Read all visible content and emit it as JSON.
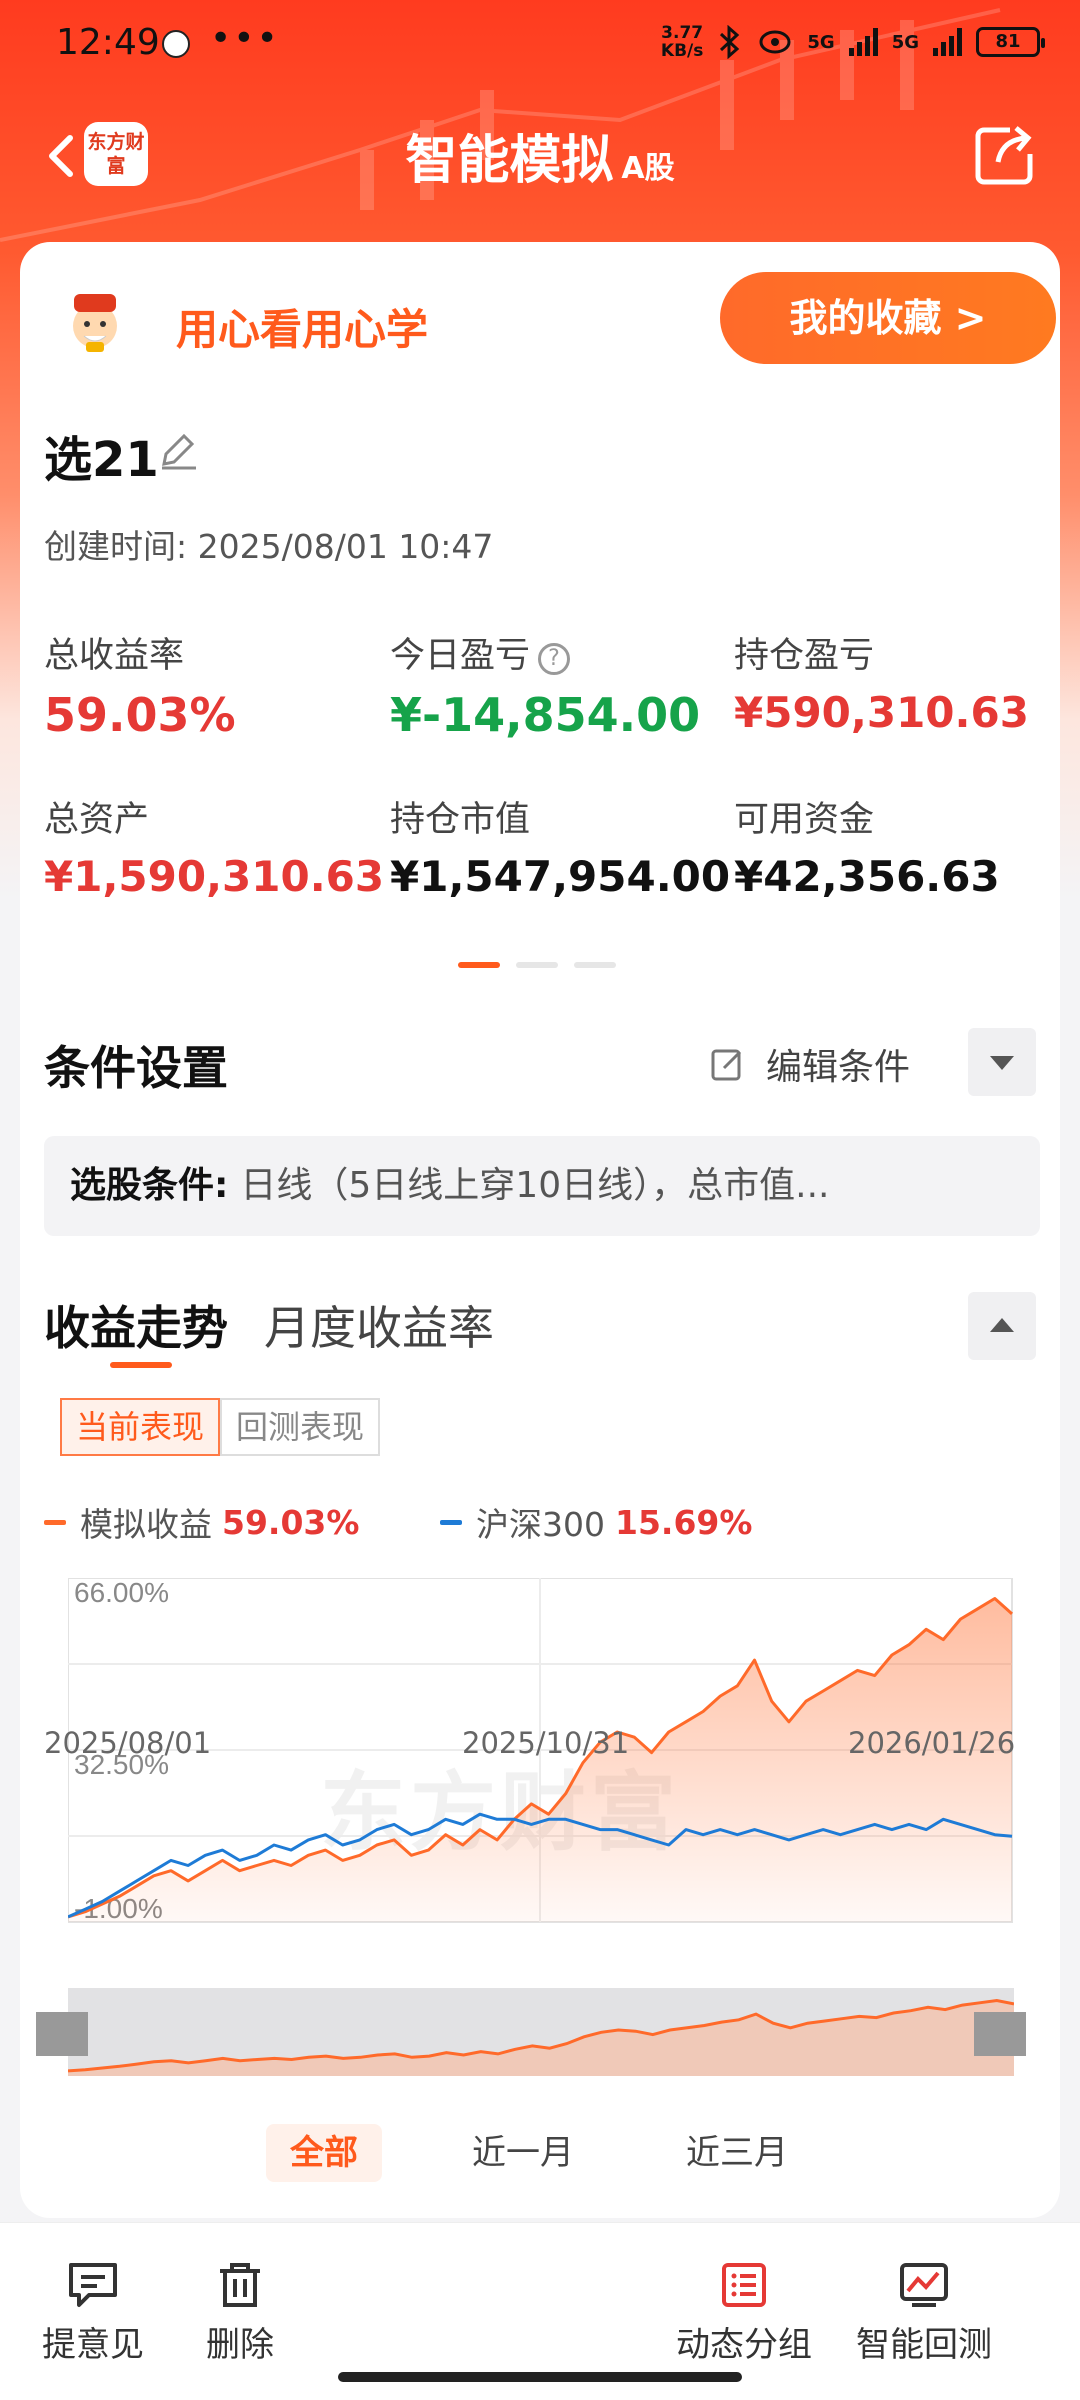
{
  "status_bar": {
    "time": "12:49",
    "net_speed_value": "3.77",
    "net_speed_unit": "KB/s",
    "signal1": "5G",
    "signal2": "5G",
    "battery": "81"
  },
  "nav": {
    "logo_text": "东方财富",
    "title": "智能模拟",
    "title_suffix": "A股"
  },
  "tab": {
    "slogan": "用心看用心学",
    "favorites_button": "我的收藏 >"
  },
  "strategy": {
    "name": "选21",
    "created_label": "创建时间:",
    "created_value": "2025/08/01 10:47"
  },
  "stats": {
    "total_return_label": "总收益率",
    "total_return_value": "59.03%",
    "today_pnl_label": "今日盈亏",
    "today_pnl_value": "¥-14,854.00",
    "position_pnl_label": "持仓盈亏",
    "position_pnl_value": "¥590,310.63",
    "total_assets_label": "总资产",
    "total_assets_value": "¥1,590,310.63",
    "market_value_label": "持仓市值",
    "market_value_value": "¥1,547,954.00",
    "available_label": "可用资金",
    "available_value": "¥42,356.63"
  },
  "conditions": {
    "title": "条件设置",
    "edit_label": "编辑条件",
    "box_label": "选股条件:",
    "box_value": "日线（5日线上穿10日线），总市值..."
  },
  "performance": {
    "tab_trend": "收益走势",
    "tab_monthly": "月度收益率",
    "seg_current": "当前表现",
    "seg_backtest": "回测表现",
    "legend_sim_label": "模拟收益",
    "legend_sim_value": "59.03%",
    "legend_hs_label": "沪深300",
    "legend_hs_value": "15.69%",
    "watermark": "东方财富",
    "range_all": "全部",
    "range_1m": "近一月",
    "range_3m": "近三月"
  },
  "chart_data": {
    "type": "line",
    "y_tick_labels": [
      "66.00%",
      "32.50%",
      "-1.00%"
    ],
    "ylim": [
      -1.0,
      66.0
    ],
    "x_tick_labels": [
      "2025/08/01",
      "2025/10/31",
      "2026/01/26"
    ],
    "grid": true,
    "legend_position": "top-left",
    "series": [
      {
        "name": "模拟收益",
        "color": "#ff6a2a",
        "area": true,
        "values": [
          0,
          1,
          2.5,
          4,
          6,
          8,
          9,
          7,
          9,
          11,
          9,
          10,
          11,
          10,
          12,
          13,
          11,
          12,
          14,
          15,
          12,
          13,
          16,
          14,
          17,
          15,
          19,
          22,
          20,
          24,
          30,
          34,
          36,
          35,
          32,
          36,
          38,
          40,
          43,
          45,
          50,
          42,
          38,
          42,
          44,
          46,
          48,
          47,
          51,
          53,
          56,
          54,
          58,
          60,
          62,
          59
        ]
      },
      {
        "name": "沪深300",
        "color": "#1e7bd6",
        "area": false,
        "values": [
          0,
          1.5,
          3,
          5,
          7,
          9,
          11,
          10,
          12,
          13,
          11,
          12,
          14,
          13,
          15,
          16,
          14,
          15,
          17,
          18,
          16,
          17,
          19,
          18,
          20,
          19,
          19,
          18,
          19,
          19,
          18,
          17,
          17,
          16,
          15,
          14,
          17,
          16,
          17,
          16,
          17,
          16,
          15,
          16,
          17,
          16,
          17,
          18,
          17,
          18,
          17,
          19,
          18,
          17,
          16,
          15.69
        ]
      }
    ]
  },
  "bottom_bar": {
    "feedback": "提意见",
    "delete": "删除",
    "groups": "动态分组",
    "backtest": "智能回测"
  },
  "colors": {
    "brand_orange": "#ff5a1c",
    "up_red": "#e53935",
    "down_green": "#16a34a",
    "hs300_blue": "#1e7bd6"
  }
}
